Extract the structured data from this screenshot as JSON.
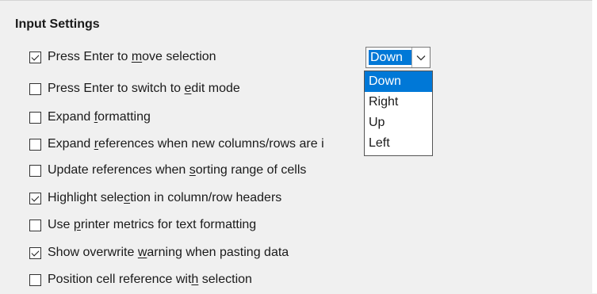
{
  "section": {
    "title": "Input Settings"
  },
  "options": [
    {
      "pre": "Press Enter to ",
      "mnemonic": "m",
      "post": "ove selection",
      "checked": true
    },
    {
      "pre": "Press Enter to switch to ",
      "mnemonic": "e",
      "post": "dit mode",
      "checked": false
    },
    {
      "pre": "Expand ",
      "mnemonic": "f",
      "post": "ormatting",
      "checked": false
    },
    {
      "pre": "Expand ",
      "mnemonic": "r",
      "post": "eferences when new columns/rows are i",
      "checked": false
    },
    {
      "pre": "Update references when ",
      "mnemonic": "s",
      "post": "orting range of cells",
      "checked": false
    },
    {
      "pre": "Highlight sele",
      "mnemonic": "c",
      "post": "tion in column/row headers",
      "checked": true
    },
    {
      "pre": "Use ",
      "mnemonic": "p",
      "post": "rinter metrics for text formatting",
      "checked": false
    },
    {
      "pre": "Show overwrite ",
      "mnemonic": "w",
      "post": "arning when pasting data",
      "checked": true
    },
    {
      "pre": "Position cell reference wit",
      "mnemonic": "h",
      "post": " selection",
      "checked": false
    }
  ],
  "direction_select": {
    "value": "Down",
    "options": [
      "Down",
      "Right",
      "Up",
      "Left"
    ],
    "highlighted": "Down"
  },
  "colors": {
    "accent": "#0078d7",
    "panel_bg": "#f0f0f0"
  }
}
